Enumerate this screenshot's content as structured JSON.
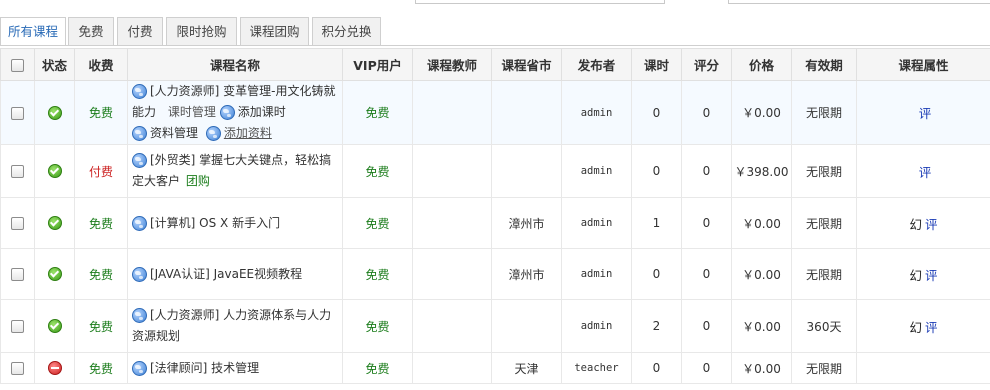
{
  "tabs": [
    {
      "label": "所有课程",
      "active": true
    },
    {
      "label": "免费",
      "active": false
    },
    {
      "label": "付费",
      "active": false
    },
    {
      "label": "限时抢购",
      "active": false
    },
    {
      "label": "课程团购",
      "active": false
    },
    {
      "label": "积分兑换",
      "active": false
    }
  ],
  "columns": {
    "status": "状态",
    "charge": "收费",
    "name": "课程名称",
    "vip": "VIP用户",
    "teacher": "课程教师",
    "province": "课程省市",
    "publisher": "发布者",
    "hours": "课时",
    "score": "评分",
    "price": "价格",
    "validity": "有效期",
    "attr": "课程属性"
  },
  "rows": [
    {
      "status": "ok-icon",
      "charge": "免费",
      "charge_type": "free",
      "name": "[人力资源师] 变革管理-用文化铸就能力",
      "links": [
        "课时管理",
        "添加课时",
        "资料管理",
        "添加资料"
      ],
      "vip": "免费",
      "teacher": "",
      "province": "",
      "publisher": "admin",
      "hours": "0",
      "score": "0",
      "price": "￥0.00",
      "validity": "无限期",
      "attr_huan": "",
      "attr_ping": "评"
    },
    {
      "status": "ok-icon",
      "charge": "付费",
      "charge_type": "paid",
      "name": "[外贸类] 掌握七大关键点，轻松搞定大客户",
      "groupbuy": "团购",
      "vip": "免费",
      "teacher": "",
      "province": "",
      "publisher": "admin",
      "hours": "0",
      "score": "0",
      "price": "￥398.00",
      "validity": "无限期",
      "attr_huan": "",
      "attr_ping": "评"
    },
    {
      "status": "ok-icon",
      "charge": "免费",
      "charge_type": "free",
      "name": "[计算机] OS X 新手入门",
      "vip": "免费",
      "teacher": "",
      "province": "漳州市",
      "publisher": "admin",
      "hours": "1",
      "score": "0",
      "price": "￥0.00",
      "validity": "无限期",
      "attr_huan": "幻",
      "attr_ping": "评"
    },
    {
      "status": "ok-icon",
      "charge": "免费",
      "charge_type": "free",
      "name": "[JAVA认证] JavaEE视频教程",
      "vip": "免费",
      "teacher": "",
      "province": "漳州市",
      "publisher": "admin",
      "hours": "0",
      "score": "0",
      "price": "￥0.00",
      "validity": "无限期",
      "attr_huan": "幻",
      "attr_ping": "评"
    },
    {
      "status": "ok-icon",
      "charge": "免费",
      "charge_type": "free",
      "name": "[人力资源师] 人力资源体系与人力资源规划",
      "vip": "免费",
      "teacher": "",
      "province": "",
      "publisher": "admin",
      "hours": "2",
      "score": "0",
      "price": "￥0.00",
      "validity": "360天",
      "attr_huan": "幻",
      "attr_ping": "评"
    },
    {
      "status": "stop-icon",
      "charge": "免费",
      "charge_type": "free",
      "name": "[法律顾问] 技术管理",
      "vip": "免费",
      "teacher": "",
      "province": "天津",
      "publisher": "teacher",
      "hours": "0",
      "score": "0",
      "price": "￥0.00",
      "validity": "无限期",
      "attr_huan": "",
      "attr_ping": ""
    }
  ]
}
